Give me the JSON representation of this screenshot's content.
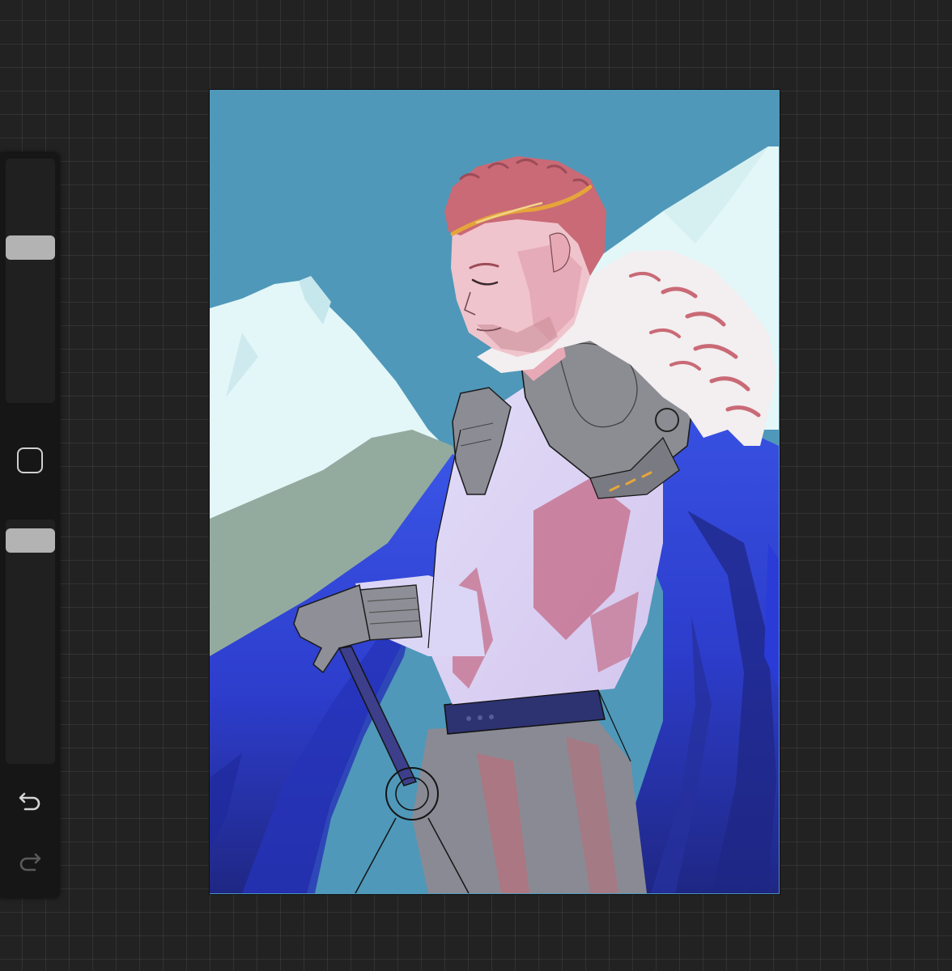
{
  "app": {
    "theme": {
      "workspace_bg": "#222222",
      "sidebar_bg": "#161616",
      "slider_track": "#202020",
      "slider_thumb": "#b3b3b3",
      "icon_color": "#cfcfcf"
    }
  },
  "sidebar": {
    "brush_size_slider": {
      "value": 0.35
    },
    "brush_opacity_slider": {
      "value": 0.04
    },
    "modify_button": {
      "icon": "square-outline-icon"
    },
    "undo_button": {
      "icon": "undo-icon",
      "enabled": true
    },
    "redo_button": {
      "icon": "redo-icon",
      "enabled": false
    }
  },
  "canvas": {
    "content": "artwork",
    "palette": {
      "sky": "#4f98b9",
      "snow": "#e3f7f8",
      "hill": "#93ab9f",
      "cape": "#3446d6",
      "cape_shadow": "#1f2784",
      "shirt": "#d9d5f5",
      "shirt_shade": "#c77a97",
      "armor": "#8c8c93",
      "skin": "#f0c4cc",
      "hair": "#c96a76",
      "fur": "#f3eef0",
      "circlet": "#e6a53a"
    }
  }
}
